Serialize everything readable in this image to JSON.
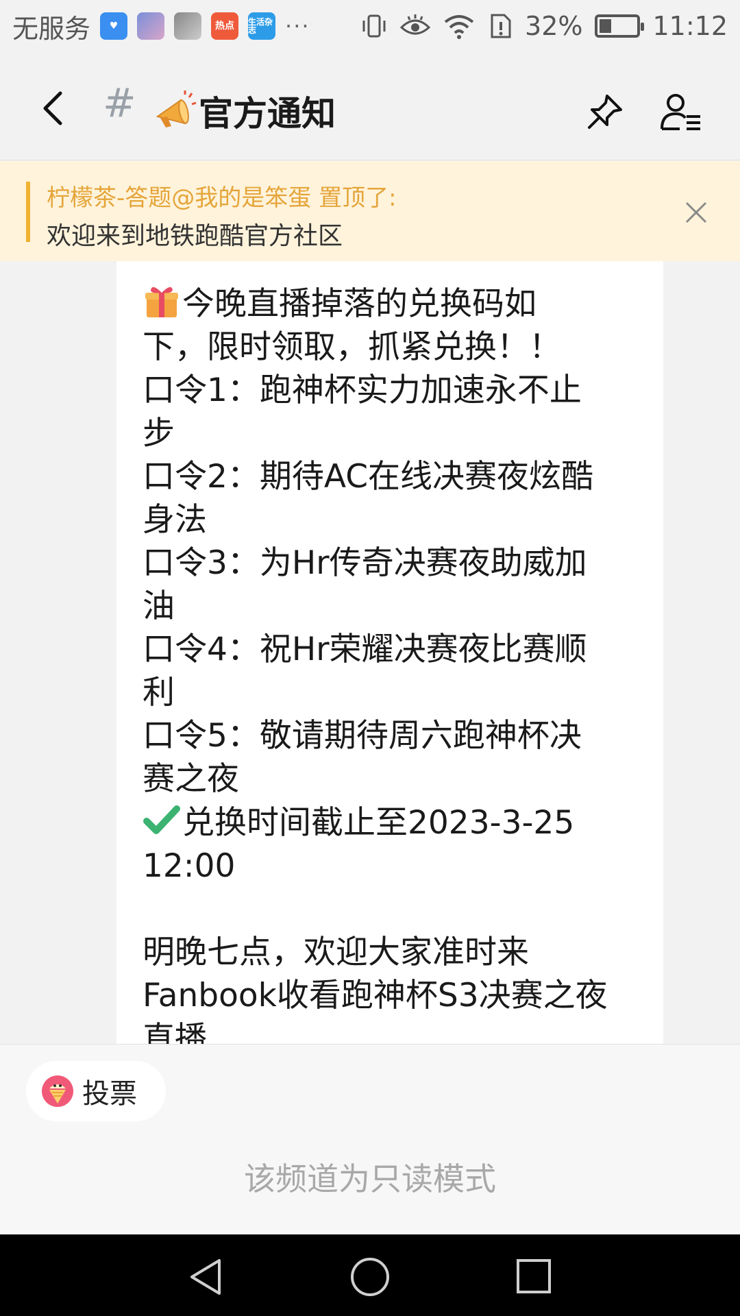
{
  "status_bar": {
    "carrier": "无服务",
    "app_icons": [
      "health-app-icon",
      "game-app-icon",
      "game-app-icon-2",
      "hot-news-icon",
      "life-magazine-icon"
    ],
    "hot_label": "热点",
    "life_label": "生活杂志",
    "more": "···",
    "battery": "32%",
    "battery_level": 0.32,
    "time": "11:12"
  },
  "header": {
    "hash": "#",
    "title": "官方通知"
  },
  "pinned": {
    "who": "柠檬茶-答题@我的是笨蛋 置顶了:",
    "text": "欢迎来到地铁跑酷官方社区"
  },
  "message": {
    "lines": [
      "今晚直播掉落的兑换码如",
      "下，限时领取，抓紧兑换！！",
      "口令1：跑神杯实力加速永不止",
      "步",
      "口令2：期待AC在线决赛夜炫酷",
      "身法",
      "口令3：为Hr传奇决赛夜助威加",
      "油",
      "口令4：祝Hr荣耀决赛夜比赛顺",
      "利",
      "口令5：敬请期待周六跑神杯决",
      "赛之夜",
      "兑换时间截止至2023-3-25",
      "12:00",
      "",
      "明晚七点，欢迎大家准时来",
      "Fanbook收看跑神杯S3决赛之夜",
      "直播"
    ]
  },
  "bottom": {
    "vote_label": "投票",
    "readonly_text": "该频道为只读模式"
  },
  "colors": {
    "pinned_bg": "#fff3db",
    "pinned_accent": "#f0b230",
    "check_green": "#3cb371"
  }
}
